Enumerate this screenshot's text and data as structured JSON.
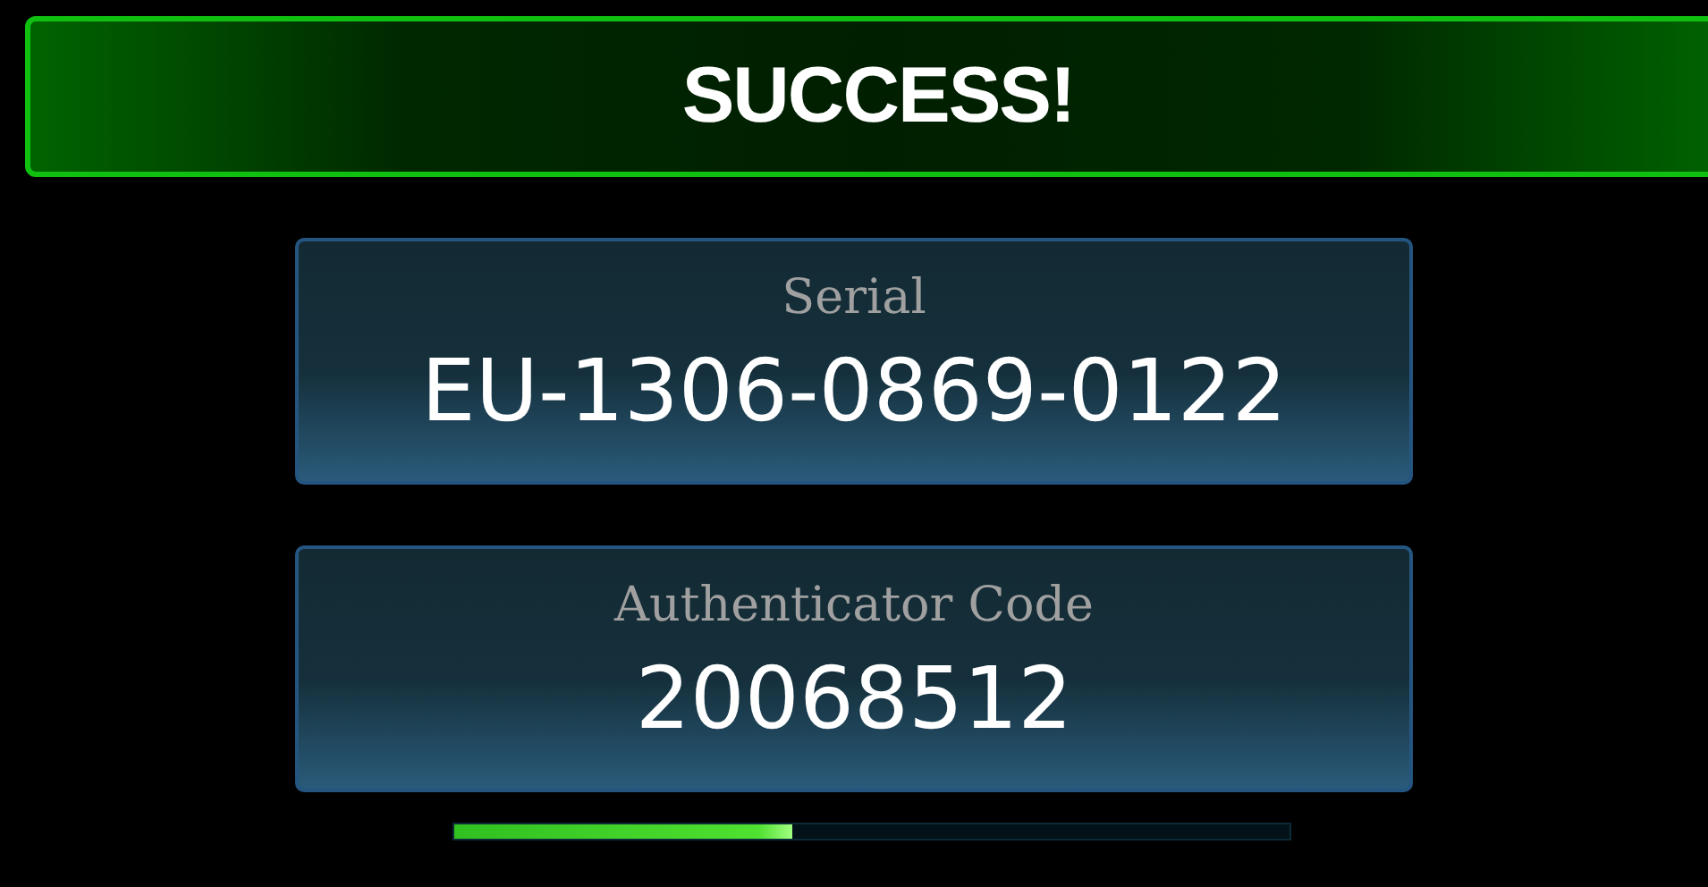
{
  "banner": {
    "title": "SUCCESS!"
  },
  "fields": [
    {
      "label": "Serial",
      "value": "EU-1306-0869-0122"
    },
    {
      "label": "Authenticator Code",
      "value": "20068512"
    }
  ],
  "progress": {
    "level": 0.405
  }
}
